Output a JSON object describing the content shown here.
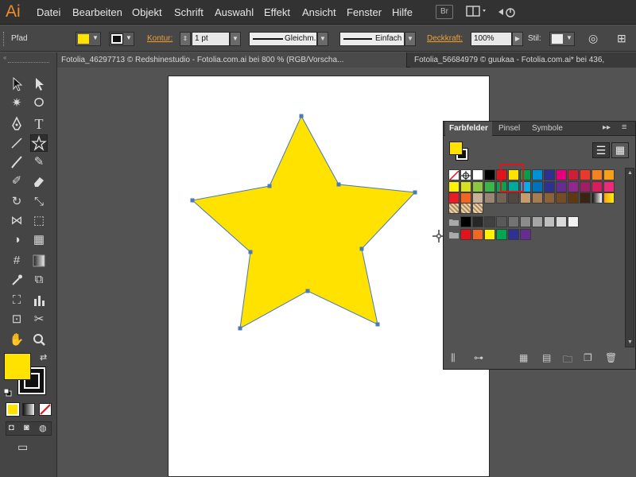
{
  "app": {
    "logo": "Ai"
  },
  "menu": [
    "Datei",
    "Bearbeiten",
    "Objekt",
    "Schrift",
    "Auswahl",
    "Effekt",
    "Ansicht",
    "Fenster",
    "Hilfe"
  ],
  "menubar_right": {
    "bridge_label": "Br"
  },
  "control": {
    "object_type": "Pfad",
    "stroke_label": "Kontur:",
    "stroke_weight": "1 pt",
    "stroke_profile": "Gleichm.",
    "brush": "Einfach",
    "opacity_label": "Deckkraft:",
    "opacity_value": "100%",
    "style_label": "Stil:"
  },
  "doc_tabs": [
    "Fotolia_46297713 © Redshinestudio - Fotolia.com.ai bei 800 % (RGB/Vorscha...",
    "Fotolia_56684979 © guukaa - Fotolia.com.ai* bei 436,"
  ],
  "colors": {
    "fill": "#ffe200",
    "star_stroke": "#4a7ab8",
    "accent": "#f0a030"
  },
  "panel": {
    "tabs": [
      "Farbfelder",
      "Pinsel",
      "Symbole"
    ],
    "swatch_rows": [
      [
        "none",
        "registration",
        "#ffffff",
        "#000000",
        "#e1141b",
        "#ffe200",
        "#00a14b",
        "#0091d5",
        "#2e3192",
        "#e4007c",
        "#cf1f36",
        "#e9392a",
        "#f5821f",
        "#f7a11a"
      ],
      [
        "#fff100",
        "#d7df23",
        "#8dc63f",
        "#39b54a",
        "#00a651",
        "#00a99d",
        "#00aeef",
        "#0072bc",
        "#2e3192",
        "#662d91",
        "#92278f",
        "#9e1f63",
        "#da1c5c",
        "#ee2a7b"
      ],
      [
        "#ed1c24",
        "#f26522",
        "#c7b299",
        "#998675",
        "#736357",
        "#534741",
        "#c69c6d",
        "#a67c52",
        "#8c6239",
        "#754c24",
        "#603913",
        "#3c2415",
        "gradient-gray",
        "gradient-orange"
      ],
      [
        "pattern-a",
        "pattern-b",
        "pattern-c"
      ],
      [
        "folder",
        "#000000",
        "#262626",
        "#404040",
        "#595959",
        "#737373",
        "#8c8c8c",
        "#a6a6a6",
        "#bfbfbf",
        "#d9d9d9",
        "#f2f2f2"
      ],
      [
        "folder",
        "#e1141b",
        "#f26522",
        "#fff100",
        "#00a651",
        "#2e3192",
        "#662d91"
      ]
    ]
  }
}
